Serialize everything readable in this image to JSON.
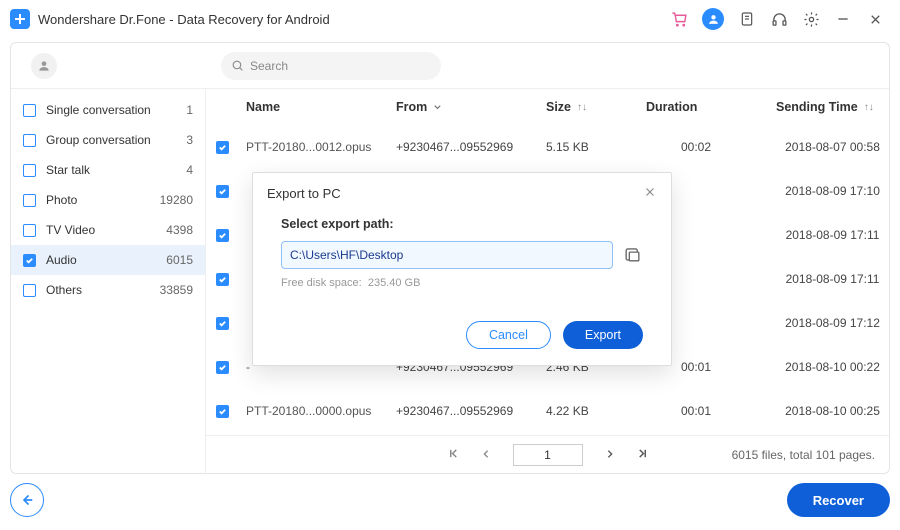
{
  "header": {
    "title": "Wondershare Dr.Fone - Data Recovery for Android"
  },
  "search": {
    "placeholder": "Search"
  },
  "sidebar": {
    "items": [
      {
        "label": "Single conversation",
        "count": "1",
        "checked": false
      },
      {
        "label": "Group conversation",
        "count": "3",
        "checked": false
      },
      {
        "label": "Star talk",
        "count": "4",
        "checked": false
      },
      {
        "label": "Photo",
        "count": "19280",
        "checked": false
      },
      {
        "label": "TV Video",
        "count": "4398",
        "checked": false
      },
      {
        "label": "Audio",
        "count": "6015",
        "checked": true
      },
      {
        "label": "Others",
        "count": "33859",
        "checked": false
      }
    ]
  },
  "columns": {
    "name": "Name",
    "from": "From",
    "size": "Size",
    "duration": "Duration",
    "sendTime": "Sending Time"
  },
  "rows": [
    {
      "name": "PTT-20180...0012.opus",
      "from": "+9230467...09552969",
      "size": "5.15 KB",
      "duration": "00:02",
      "sendTime": "2018-08-07 00:58"
    },
    {
      "name": "",
      "from": "",
      "size": "",
      "duration": "",
      "sendTime": "2018-08-09 17:10"
    },
    {
      "name": "",
      "from": "",
      "size": "",
      "duration": "",
      "sendTime": "2018-08-09 17:11"
    },
    {
      "name": "",
      "from": "",
      "size": "",
      "duration": "",
      "sendTime": "2018-08-09 17:11"
    },
    {
      "name": "",
      "from": "",
      "size": "",
      "duration": "",
      "sendTime": "2018-08-09 17:12"
    },
    {
      "name": "-",
      "from": "+9230467...09552969",
      "size": "2.46 KB",
      "duration": "00:01",
      "sendTime": "2018-08-10 00:22"
    },
    {
      "name": "PTT-20180...0000.opus",
      "from": "+9230467...09552969",
      "size": "4.22 KB",
      "duration": "00:01",
      "sendTime": "2018-08-10 00:25"
    }
  ],
  "pager": {
    "page": "1",
    "info": "6015 files, total 101 pages."
  },
  "footer": {
    "recover": "Recover"
  },
  "modal": {
    "title": "Export to PC",
    "label": "Select export path:",
    "path": "C:\\Users\\HF\\Desktop",
    "freeSpaceLabel": "Free disk space:",
    "freeSpace": "235.40 GB",
    "cancel": "Cancel",
    "export": "Export"
  }
}
